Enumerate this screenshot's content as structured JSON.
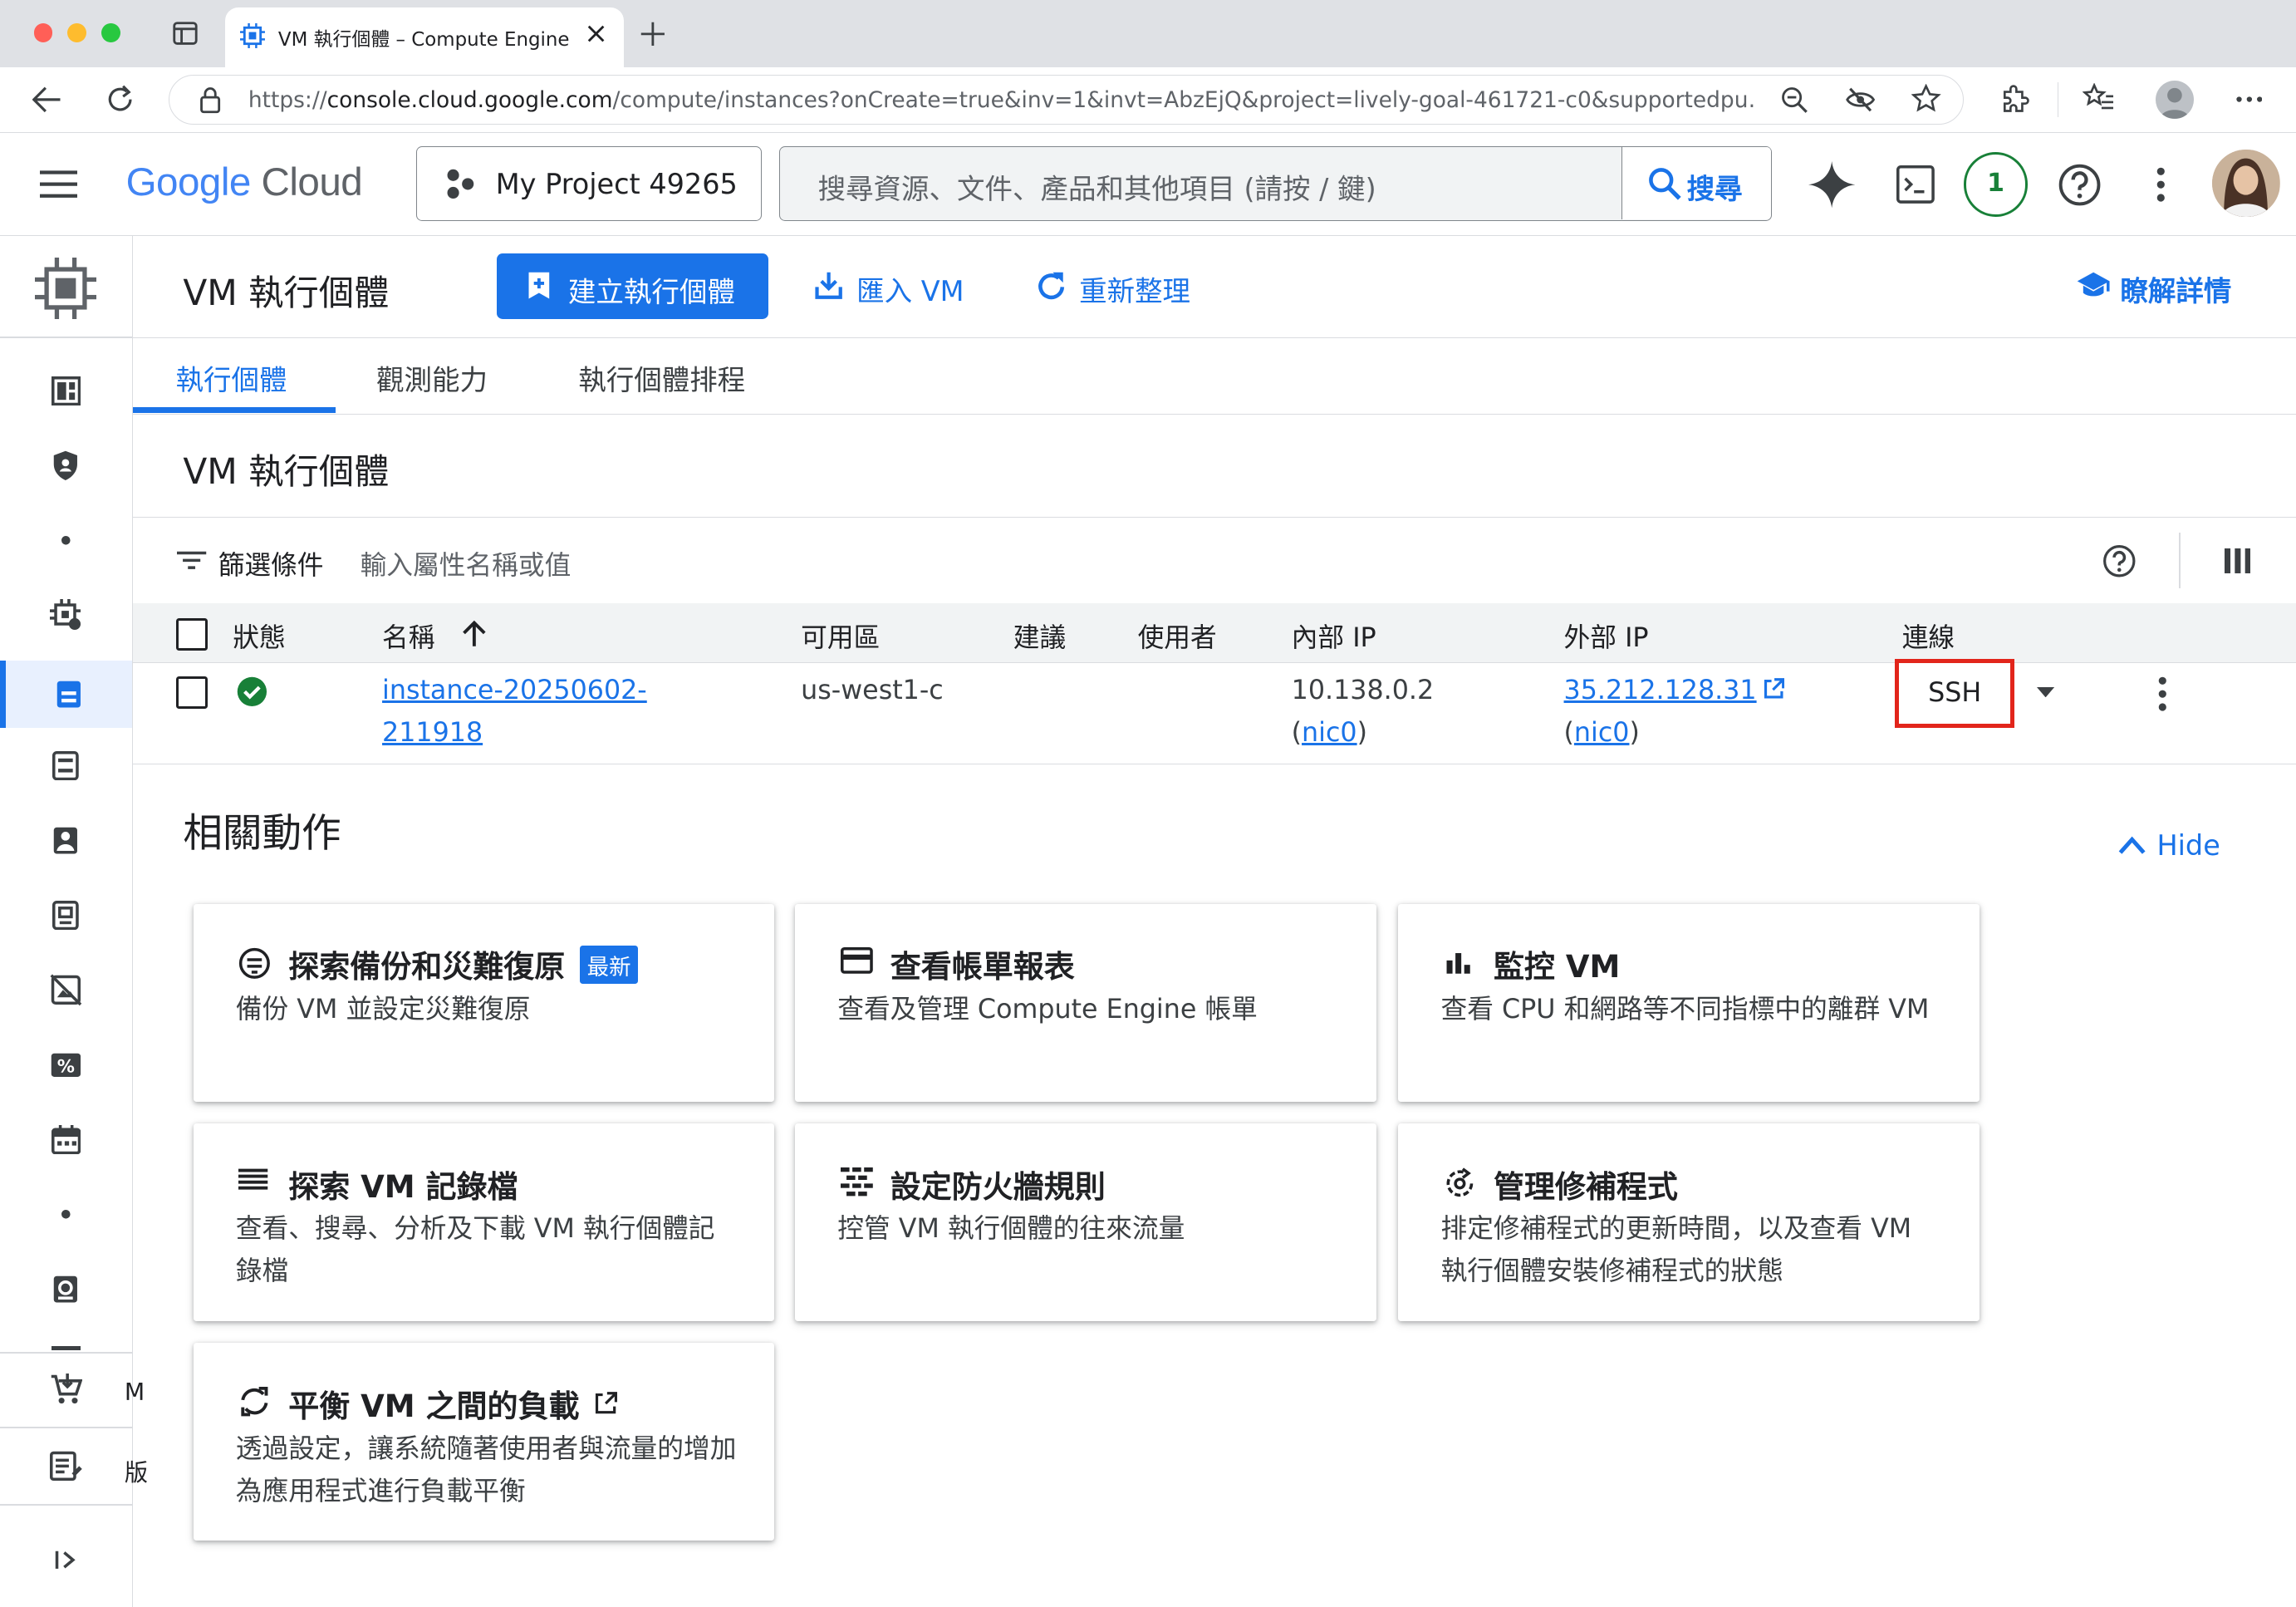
{
  "browser": {
    "tab_title": "VM 執行個體 – Compute Engine",
    "url_prefix": "https://",
    "url_host": "console.cloud.google.com",
    "url_path": "/compute/instances?onCreate=true&inv=1&invt=AbzEjQ&project=lively-goal-461721-c0&supportedpu…"
  },
  "header": {
    "logo_google": "Google",
    "logo_cloud": "Cloud",
    "project": "My Project 49265",
    "search_placeholder": "搜尋資源、文件、產品和其他項目 (請按 / 鍵)",
    "search_button": "搜尋",
    "notification_count": "1"
  },
  "page": {
    "title": "VM 執行個體",
    "create_button": "建立執行個體",
    "import_button": "匯入 VM",
    "refresh_button": "重新整理",
    "learn_button": "瞭解詳情",
    "tabs": [
      "執行個體",
      "觀測能力",
      "執行個體排程"
    ],
    "section_title": "VM 執行個體"
  },
  "filter": {
    "label": "篩選條件",
    "placeholder": "輸入屬性名稱或值"
  },
  "table": {
    "columns": [
      "狀態",
      "名稱",
      "可用區",
      "建議",
      "使用者",
      "內部 IP",
      "外部 IP",
      "連線"
    ],
    "rows": [
      {
        "name_line1": "instance-20250602-",
        "name_line2": "211918",
        "zone": "us-west1-c",
        "internal_ip": "10.138.0.2",
        "internal_nic_open": "(",
        "internal_nic": "nic0",
        "internal_nic_close": ")",
        "external_ip": "35.212.128.31",
        "external_nic_open": "(",
        "external_nic": "nic0",
        "external_nic_close": ")",
        "connect": "SSH"
      }
    ]
  },
  "related": {
    "title": "相關動作",
    "hide_label": "Hide",
    "new_badge": "最新",
    "cards": [
      {
        "title": "探索備份和災難復原",
        "desc": "備份 VM 並設定災難復原",
        "icon": "backup-icon"
      },
      {
        "title": "查看帳單報表",
        "desc": "查看及管理 Compute Engine 帳單",
        "icon": "billing-icon"
      },
      {
        "title": "監控 VM",
        "desc": "查看 CPU 和網路等不同指標中的離群 VM",
        "icon": "bar-chart-icon"
      },
      {
        "title": "探索 VM 記錄檔",
        "desc": "查看、搜尋、分析及下載 VM 執行個體記錄檔",
        "icon": "logs-icon"
      },
      {
        "title": "設定防火牆規則",
        "desc": "控管 VM 執行個體的往來流量",
        "icon": "firewall-icon"
      },
      {
        "title": "管理修補程式",
        "desc": "排定修補程式的更新時間，以及查看 VM 執行個體安裝修補程式的狀態",
        "icon": "patch-icon"
      },
      {
        "title": "平衡 VM 之間的負載",
        "desc": "透過設定，讓系統隨著使用者與流量的增加為應用程式進行負載平衡",
        "icon": "load-balance-icon"
      }
    ]
  },
  "colors": {
    "accent": "#1a73e8",
    "running": "#188038",
    "highlight": "#e2251b"
  }
}
